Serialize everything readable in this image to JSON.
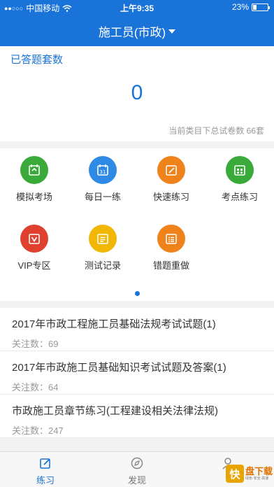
{
  "status_bar": {
    "signal_dots": "●●○○○",
    "carrier": "中国移动",
    "time": "上午9:35",
    "battery": "23%",
    "battery_level": 0.23
  },
  "navbar": {
    "title": "施工员(市政)"
  },
  "summary": {
    "label": "已答题套数",
    "count": "0",
    "total_text": "当前类目下总试卷数 66套"
  },
  "grid": [
    {
      "label": "模拟考场",
      "color": "#3aab3a",
      "icon": "exam-icon"
    },
    {
      "label": "每日一练",
      "color": "#2f8ae5",
      "icon": "calendar-icon"
    },
    {
      "label": "快速练习",
      "color": "#f0821c",
      "icon": "edit-icon"
    },
    {
      "label": "考点练习",
      "color": "#3aab3a",
      "icon": "grid-calendar-icon"
    },
    {
      "label": "VIP专区",
      "color": "#e04030",
      "icon": "vip-icon"
    },
    {
      "label": "测试记录",
      "color": "#f2b705",
      "icon": "record-icon"
    },
    {
      "label": "错题重做",
      "color": "#f0821c",
      "icon": "wrong-list-icon"
    }
  ],
  "list": [
    {
      "title": "2017年市政工程施工员基础法规考试试题(1)",
      "follow": "关注数：69"
    },
    {
      "title": "2017年市政施工员基础知识考试试题及答案(1)",
      "follow": "关注数：64"
    },
    {
      "title": "市政施工员章节练习(工程建设相关法律法规)",
      "follow": "关注数：247"
    }
  ],
  "tabs": [
    {
      "label": "练习",
      "icon": "pencil-square-icon",
      "active": true
    },
    {
      "label": "发现",
      "icon": "compass-icon",
      "active": false
    },
    {
      "label": "",
      "icon": "user-icon",
      "active": false
    }
  ],
  "watermark": {
    "badge": "快",
    "text": "盘下载",
    "sub": "绿色·安全·高速"
  },
  "colors": {
    "primary": "#1a73d9"
  }
}
